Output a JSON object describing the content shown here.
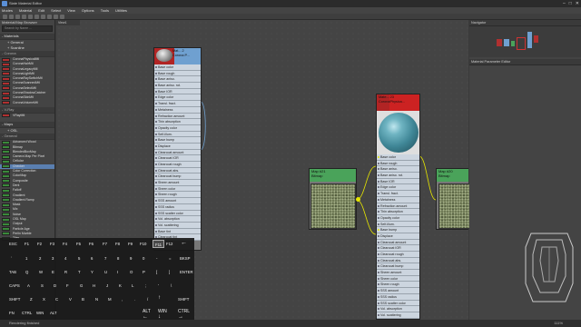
{
  "window": {
    "title": "Slate Material Editor"
  },
  "menu": [
    "Modes",
    "Material",
    "Edit",
    "Select",
    "View",
    "Options",
    "Tools",
    "Utilities"
  ],
  "browser": {
    "title": "Material/Map Browser",
    "search_placeholder": "Search by Name ...",
    "categories": {
      "materials": "- Materials",
      "general": "+ General",
      "scanline": "+ Scanline",
      "corona": "- Corona",
      "vray": "- V-Ray",
      "maps": "- Maps",
      "osl": "+ OSL",
      "general_maps": "- General"
    },
    "corona_items": [
      "CoronaPhysicalMtl",
      "CoronaHairMtl",
      "CoronaLegacyMtl",
      "CoronaLightMtl",
      "CoronaRaySwitchMtl",
      "CoronaScannedMtl",
      "CoronaSelectMtl",
      "CoronaShadowCatcher",
      "CoronaSkinMtl",
      "CoronaVolumeMtl"
    ],
    "vray_items": [
      "VRayMtl"
    ],
    "map_items": [
      "Advanced Wood",
      "Bitmap",
      "BlendedBoxMap",
      "Camera Map Per Pixel",
      "Cellular",
      "Checker",
      "Color Correction",
      "ColorMap",
      "Composite",
      "Dent",
      "Falloff",
      "Gradient",
      "Gradient Ramp",
      "Mask",
      "Mix",
      "Noise",
      "OSL Map",
      "Output",
      "Particle Age",
      "Perlin Marble",
      "Tiles"
    ]
  },
  "view": {
    "tab": "View1"
  },
  "nodes": {
    "material_a": {
      "name": "Mat... 2",
      "type": "Corona P...",
      "slots": [
        "Base color",
        "Base rough",
        "Base aniso.",
        "Base aniso. rot.",
        "Base IOR",
        "Edge color",
        "Transl. fract.",
        "Metalness",
        "Refraction amount",
        "Thin absorption",
        "Opacity color",
        "Self-illum.",
        "Base bump",
        "Displace",
        "Clearcoat amount",
        "Clearcoat IOR",
        "Clearcoat rough",
        "Clearcoat abs.",
        "Clearcoat bump",
        "Sheen amount",
        "Sheen color",
        "Sheen rough",
        "SSS amount",
        "SSS radius",
        "SSS scatter color",
        "Vol. absorption",
        "Vol. scattering",
        "Base tint",
        "Clearcoat tint"
      ]
    },
    "map_21": {
      "name": "Map #21",
      "type": "Bitmap"
    },
    "material_b": {
      "name": "Mate... 23",
      "type": "CoronaPhysica...",
      "slots": [
        "Base color",
        "Base rough",
        "Base aniso.",
        "Base aniso. rot.",
        "Base IOR",
        "Edge color",
        "Transl. fract.",
        "Metalness",
        "Refraction amount",
        "Thin absorption",
        "Opacity color",
        "Self-illum.",
        "Base bump",
        "Displace",
        "Clearcoat amount",
        "Clearcoat IOR",
        "Clearcoat rough",
        "Clearcoat abs.",
        "Clearcoat bump",
        "Sheen amount",
        "Sheen color",
        "Sheen rough",
        "SSS amount",
        "SSS radius",
        "SSS scatter color",
        "Vol. absorption",
        "Vol. scattering"
      ]
    },
    "map_20": {
      "name": "Map #20",
      "type": "Bitmap"
    }
  },
  "navigator": {
    "title": "Navigator"
  },
  "param_editor": {
    "title": "Material Parameter Editor"
  },
  "keyboard": {
    "row1": [
      "ESC",
      "F1",
      "F2",
      "F3",
      "F4",
      "F5",
      "F6",
      "F7",
      "F8",
      "F9",
      "F10",
      "F11",
      "F12",
      "←"
    ],
    "row2": [
      "`",
      "1",
      "2",
      "3",
      "4",
      "5",
      "6",
      "7",
      "8",
      "9",
      "0",
      "-",
      "=",
      "BKSP"
    ],
    "row3": [
      "TAB",
      "Q",
      "W",
      "E",
      "R",
      "T",
      "Y",
      "U",
      "I",
      "O",
      "P",
      "[",
      "]",
      "ENTER"
    ],
    "row4": [
      "CAPS",
      "A",
      "S",
      "D",
      "F",
      "G",
      "H",
      "J",
      "K",
      "L",
      ";",
      "'",
      "\\",
      ""
    ],
    "row5": [
      "SHIFT",
      "Z",
      "X",
      "C",
      "V",
      "B",
      "N",
      "M",
      ",",
      ".",
      "/",
      "↑",
      "SHIFT"
    ],
    "row6": [
      "FN",
      "CTRL",
      "WIN",
      "ALT",
      "",
      "",
      "",
      "",
      "ALT",
      "←",
      "↓",
      "→"
    ],
    "row6b": [
      "ALT",
      "WIN",
      "CTRL"
    ]
  },
  "status": {
    "text": "Rendering finished",
    "zoom": "111%"
  }
}
